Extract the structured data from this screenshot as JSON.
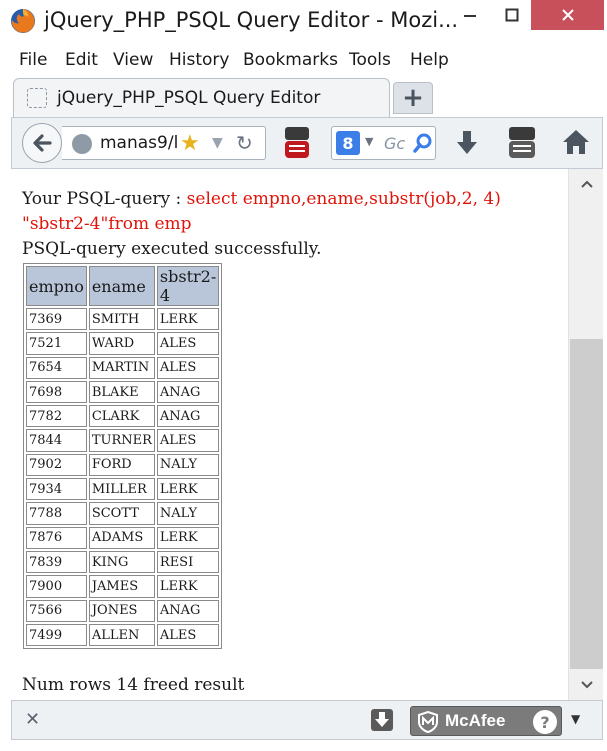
{
  "window": {
    "title": "jQuery_PHP_PSQL Query Editor - Mozi...",
    "minimize_glyph": "—",
    "maximize_glyph": "☐",
    "close_glyph": "✕"
  },
  "menu": {
    "items": [
      "File",
      "Edit",
      "View",
      "History",
      "Bookmarks",
      "Tools",
      "Help"
    ]
  },
  "tab": {
    "title": "jQuery_PHP_PSQL Query Editor",
    "new_tab_glyph": "+"
  },
  "navbar": {
    "url": "manas9/l",
    "search_placeholder": "Gc",
    "search_engine_glyph": "8"
  },
  "page": {
    "query_prefix": "Your PSQL-query : ",
    "query_part1": "select empno,ename,substr(job,2, 4)",
    "query_part2": "\"sbstr2-4\"from emp",
    "status": "PSQL-query executed successfully.",
    "footer": "Num rows 14 freed result",
    "table": {
      "headers": [
        "empno",
        "ename",
        "sbstr2-4"
      ],
      "rows": [
        [
          "7369",
          "SMITH",
          "LERK"
        ],
        [
          "7521",
          "WARD",
          "ALES"
        ],
        [
          "7654",
          "MARTIN",
          "ALES"
        ],
        [
          "7698",
          "BLAKE",
          "ANAG"
        ],
        [
          "7782",
          "CLARK",
          "ANAG"
        ],
        [
          "7844",
          "TURNER",
          "ALES"
        ],
        [
          "7902",
          "FORD",
          "NALY"
        ],
        [
          "7934",
          "MILLER",
          "LERK"
        ],
        [
          "7788",
          "SCOTT",
          "NALY"
        ],
        [
          "7876",
          "ADAMS",
          "LERK"
        ],
        [
          "7839",
          "KING",
          "RESI"
        ],
        [
          "7900",
          "JAMES",
          "LERK"
        ],
        [
          "7566",
          "JONES",
          "ANAG"
        ],
        [
          "7499",
          "ALLEN",
          "ALES"
        ]
      ]
    }
  },
  "addonbar": {
    "close_glyph": "✕",
    "mcafee_label": "McAfee",
    "help_glyph": "?",
    "menu_glyph": "▼"
  },
  "colors": {
    "query_text": "#e0140a",
    "header_bg": "#b9c6da",
    "close_button": "#c7505a"
  },
  "icons": [
    "firefox-logo-icon",
    "back-arrow-icon",
    "globe-icon",
    "star-icon",
    "reload-icon",
    "youtube-icon",
    "google-icon",
    "search-icon",
    "download-icon",
    "home-icon",
    "mcafee-shield-icon"
  ]
}
